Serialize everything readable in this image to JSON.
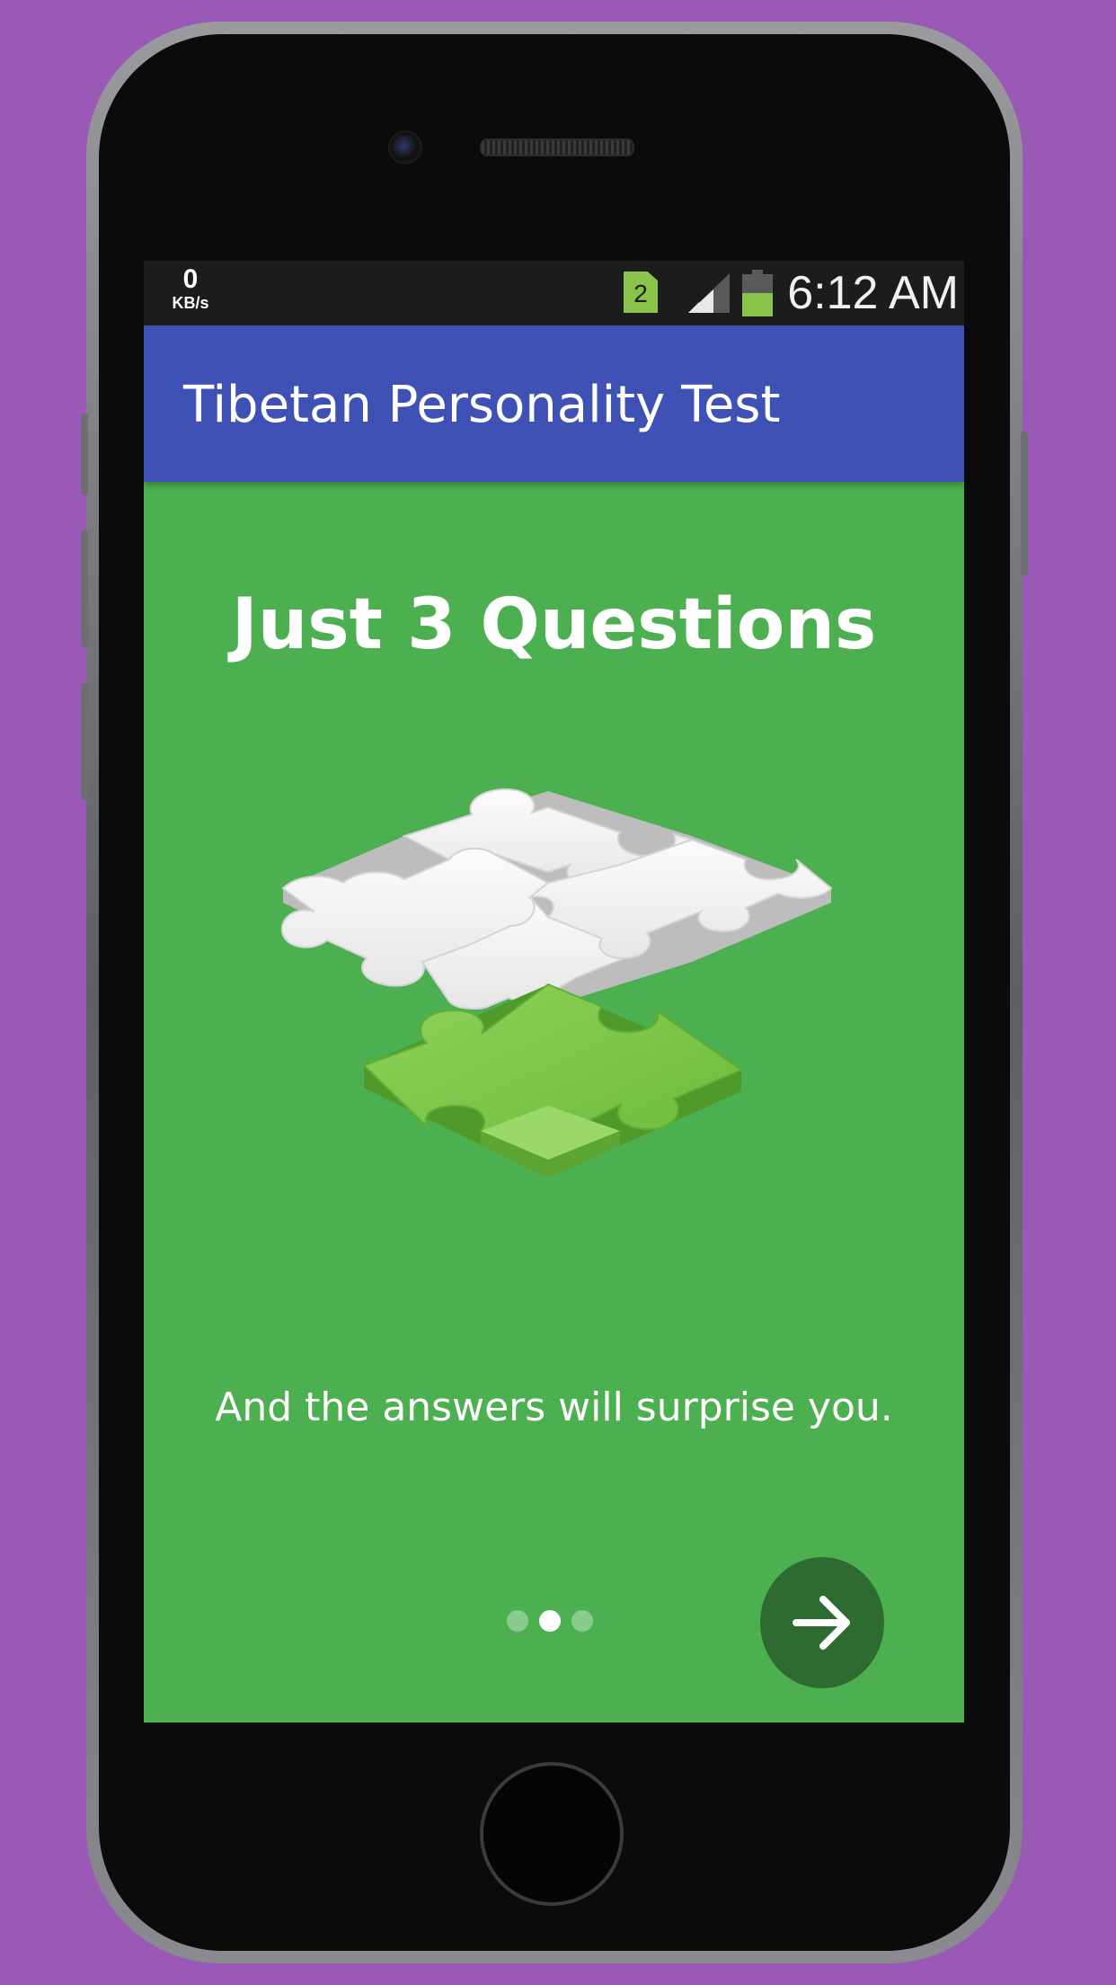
{
  "status_bar": {
    "net_speed_value": "0",
    "net_speed_unit": "KB/s",
    "sim_slot": "2",
    "time": "6:12 AM",
    "icons": [
      "sim-card-icon",
      "signal-icon",
      "battery-icon"
    ]
  },
  "app_bar": {
    "title": "Tibetan Personality Test"
  },
  "onboarding": {
    "headline": "Just 3 Questions",
    "illustration": "puzzle-pieces-icon",
    "subtitle": "And the answers will surprise you.",
    "pager": {
      "total_pages": 3,
      "current_page": 2
    },
    "next_button_icon": "arrow-right-icon"
  },
  "colors": {
    "background": "#9b59b6",
    "app_bar": "#3f51b5",
    "screen": "#4caf50",
    "next_button": "#2e6b30",
    "status_bar": "#1c1c1c"
  }
}
